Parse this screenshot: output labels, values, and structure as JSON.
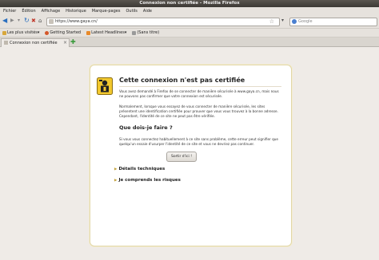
{
  "window": {
    "title": "Connexion non certifiée - Mozilla Firefox"
  },
  "menu": [
    "Fichier",
    "Édition",
    "Affichage",
    "Historique",
    "Marque-pages",
    "Outils",
    "Aide"
  ],
  "nav": {
    "url": "https://www.gaya.cn/",
    "search_placeholder": "Google"
  },
  "bookmarks": [
    {
      "label": "Les plus visités",
      "icon": "folder-icon",
      "color": "#d8a73b"
    },
    {
      "label": "Getting Started",
      "icon": "firefox-icon",
      "color": "#d4572a"
    },
    {
      "label": "Latest Headlines",
      "icon": "rss-icon",
      "color": "#e88a2a"
    },
    {
      "label": "(Sans titre)",
      "icon": "page-icon",
      "color": "#9a9a9a"
    }
  ],
  "tab": {
    "label": "Connexion non certifiée"
  },
  "error": {
    "title": "Cette connexion n'est pas certifiée",
    "p1": "Vous avez demandé à Firefox de se connecter de manière sécurisée à www.gaya.cn, mais nous ne pouvons pas confirmer que votre connexion est sécurisée.",
    "p2": "Normalement, lorsque vous essayez de vous connecter de manière sécurisée, les sites présentent une identification certifiée pour prouver que vous vous trouvez à la bonne adresse. Cependant, l'identité de ce site ne peut pas être vérifiée.",
    "what_heading": "Que dois-je faire ?",
    "p3": "Si vous vous connectez habituellement à ce site sans problème, cette erreur peut signifier que quelqu'un essaie d'usurper l'identité de ce site et vous ne devriez pas continuer.",
    "get_out_label": "Sortir d'ici !",
    "details_label": "Détails techniques",
    "understand_label": "Je comprends les risques"
  },
  "colors": {
    "card_border": "#e2d7a8",
    "warning_yellow": "#f2c82e",
    "link_blue": "#2a6fbf"
  }
}
